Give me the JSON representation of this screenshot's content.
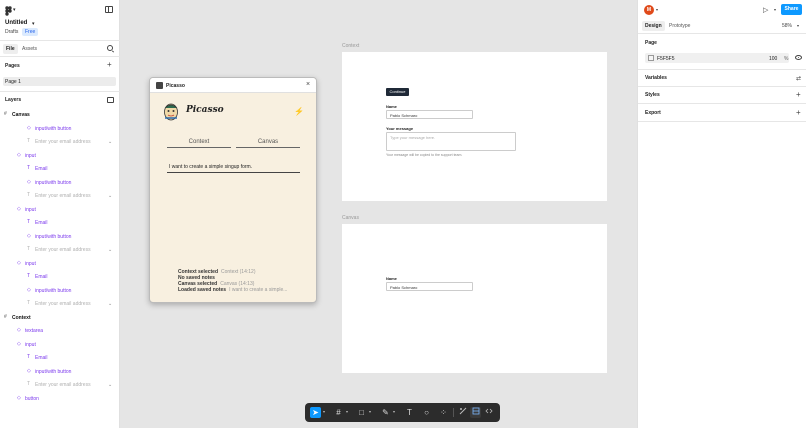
{
  "left_sidebar": {
    "logo_caret": "▾",
    "file_title": "Untitled",
    "file_caret": "▾",
    "location": "Drafts",
    "plan_badge": "Free",
    "tabs": {
      "file": "File",
      "assets": "Assets"
    },
    "pages_title": "Pages",
    "pages": [
      "Page 1"
    ],
    "layers_title": "Layers",
    "layers": [
      {
        "label": "Canvas",
        "kind": "frame",
        "icon": "#"
      },
      {
        "label": "input/with button",
        "kind": "comp",
        "icon": "◇"
      },
      {
        "label": "Enter your email address",
        "kind": "dim",
        "icon": "T",
        "chev": "⌄"
      },
      {
        "label": "input",
        "kind": "comp",
        "icon": "◇"
      },
      {
        "label": "Email",
        "kind": "comp",
        "icon": "T"
      },
      {
        "label": "input/with button",
        "kind": "comp",
        "icon": "◇"
      },
      {
        "label": "Enter your email address",
        "kind": "dim",
        "icon": "T",
        "chev": "⌄"
      },
      {
        "label": "input",
        "kind": "comp",
        "icon": "◇"
      },
      {
        "label": "Email",
        "kind": "comp",
        "icon": "T"
      },
      {
        "label": "input/with button",
        "kind": "comp",
        "icon": "◇"
      },
      {
        "label": "Enter your email address",
        "kind": "dim",
        "icon": "T",
        "chev": "⌄"
      },
      {
        "label": "input",
        "kind": "comp",
        "icon": "◇"
      },
      {
        "label": "Email",
        "kind": "comp",
        "icon": "T"
      },
      {
        "label": "input/with button",
        "kind": "comp",
        "icon": "◇"
      },
      {
        "label": "Enter your email address",
        "kind": "dim",
        "icon": "T",
        "chev": "⌄"
      },
      {
        "label": "Context",
        "kind": "frame",
        "icon": "#"
      },
      {
        "label": "textarea",
        "kind": "comp",
        "icon": "◇"
      },
      {
        "label": "input",
        "kind": "comp",
        "icon": "◇"
      },
      {
        "label": "Email",
        "kind": "comp",
        "icon": "T"
      },
      {
        "label": "input/with button",
        "kind": "comp",
        "icon": "◇"
      },
      {
        "label": "Enter your email address",
        "kind": "dim",
        "icon": "T",
        "chev": "⌄"
      },
      {
        "label": "button",
        "kind": "comp",
        "icon": "◇"
      }
    ]
  },
  "canvas": {
    "context_frame": {
      "label": "Context",
      "button": "Continue",
      "name_label": "Name",
      "name_value": "Pablo Schmaro",
      "message_label": "Your message",
      "message_placeholder": "Type your message here.",
      "helper": "Your message will be copied to the support team."
    },
    "canvas_frame": {
      "label": "Canvas",
      "name_label": "Name",
      "name_value": "Pablo Schmaro"
    }
  },
  "plugin": {
    "title": "Picasso",
    "close": "×",
    "wordmark": "Picasso",
    "lightning": "⚡",
    "tabs": [
      "Context",
      "Canvas"
    ],
    "prompt": "I want to create a simple singup form.",
    "status": [
      {
        "label": "Context selected",
        "sub": "Context (14:12)"
      },
      {
        "label": "No saved notes",
        "sub": ""
      },
      {
        "label": "Canvas selected",
        "sub": "Canvas (14:13)"
      },
      {
        "label": "Loaded saved notes",
        "sub": "I want to create a simple..."
      }
    ]
  },
  "toolbar": {
    "move": "➤",
    "frame": "#",
    "shape": "□",
    "pen": "✎",
    "text": "T",
    "comment": "○",
    "components": "⁘",
    "caret": "▾"
  },
  "help": "?",
  "right_sidebar": {
    "avatar": "M",
    "avatar_caret": "▾",
    "play": "▷",
    "play_caret": "▾",
    "share": "Share",
    "tabs": {
      "design": "Design",
      "prototype": "Prototype"
    },
    "zoom": "58%",
    "zoom_caret": "▾",
    "page_title": "Page",
    "background_hex": "F5F5F5",
    "background_opacity": "100",
    "percent": "%",
    "variables": "Variables",
    "styles": "Styles",
    "export": "Export",
    "plus": "+",
    "var_glyph": "⇄"
  },
  "colors": {
    "accent": "#0d99ff",
    "avatar": "#e04a1a",
    "component": "#7c3aed",
    "canvas_bg": "#e5e5e5"
  }
}
